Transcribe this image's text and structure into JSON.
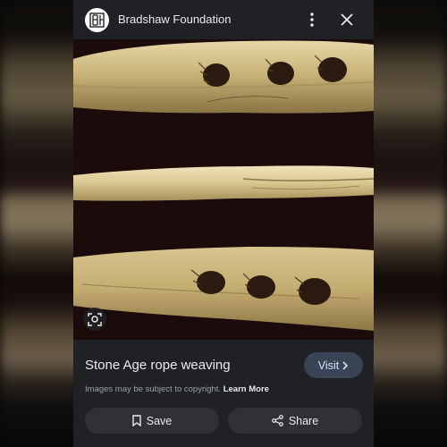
{
  "source": {
    "name": "Bradshaw Foundation",
    "logo_icon": "bradshaw-logo"
  },
  "header": {
    "more_icon": "more-vertical-icon",
    "close_icon": "close-icon"
  },
  "image": {
    "lens_icon": "lens-search-icon"
  },
  "result": {
    "title": "Stone Age rope weaving",
    "visit_label": "Visit",
    "visit_icon": "chevron-right-icon",
    "copyright_text": "Images may be subject to copyright.",
    "learn_more_label": "Learn More"
  },
  "actions": {
    "save_label": "Save",
    "save_icon": "bookmark-icon",
    "share_label": "Share",
    "share_icon": "share-icon"
  },
  "colors": {
    "panel_bg": "#202124",
    "button_bg": "#303134",
    "visit_bg": "#394457",
    "visit_text": "#d2e3fc",
    "text_primary": "#e8eaed",
    "text_secondary": "#9aa0a6"
  }
}
